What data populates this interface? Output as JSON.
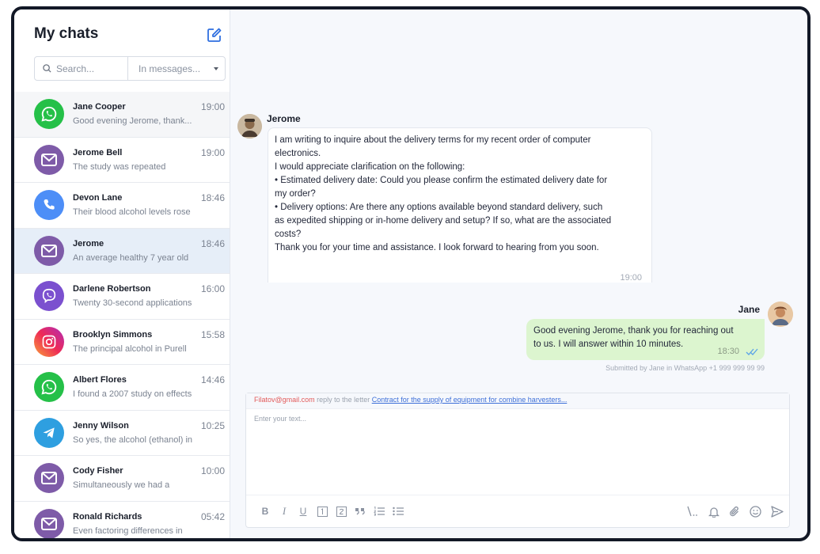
{
  "sidebar": {
    "title": "My chats",
    "search": {
      "placeholder": "Search...",
      "scope": "In messages..."
    },
    "chats": [
      {
        "name": "Jane Cooper",
        "time": "19:00",
        "preview": "Good evening Jerome, thank...",
        "channel": "whatsapp"
      },
      {
        "name": "Jerome Bell",
        "time": "19:00",
        "preview": "The study was repeated",
        "channel": "email"
      },
      {
        "name": "Devon Lane",
        "time": "18:46",
        "preview": "Their blood alcohol levels rose",
        "channel": "phone"
      },
      {
        "name": "Jerome",
        "time": "18:46",
        "preview": "An average healthy 7 year old",
        "channel": "email"
      },
      {
        "name": "Darlene Robertson",
        "time": "16:00",
        "preview": "Twenty 30-second applications",
        "channel": "viber"
      },
      {
        "name": "Brooklyn Simmons",
        "time": "15:58",
        "preview": "The principal alcohol in Purell",
        "channel": "instagram"
      },
      {
        "name": "Albert Flores",
        "time": "14:46",
        "preview": "I found a 2007 study on effects",
        "channel": "whatsapp"
      },
      {
        "name": "Jenny Wilson",
        "time": "10:25",
        "preview": "So yes, the alcohol (ethanol) in",
        "channel": "telegram"
      },
      {
        "name": "Cody Fisher",
        "time": "10:00",
        "preview": "Simultaneously we had a",
        "channel": "email"
      },
      {
        "name": "Ronald Richards",
        "time": "05:42",
        "preview": "Even factoring differences in",
        "channel": "email"
      }
    ]
  },
  "conversation": {
    "incoming": {
      "sender": "Jerome",
      "lines": [
        "I am writing to inquire about the delivery terms for my recent order of computer",
        "electronics.",
        "I would appreciate clarification on the following:",
        "• Estimated delivery date: Could you please confirm the estimated delivery date for",
        "my order?",
        "• Delivery options: Are there any options available beyond standard delivery, such",
        "as expedited shipping or in-home delivery and setup? If so, what are the associated",
        "costs?",
        "Thank you for your time and assistance. I look forward to hearing from you soon."
      ],
      "time": "19:00"
    },
    "outgoing": {
      "sender": "Jane",
      "lines": [
        "Good evening Jerome, thank you for reaching out",
        "to us. I will answer within 10 minutes."
      ],
      "time": "18:30",
      "meta": "Submitted by Jane in WhatsApp +1 999 999 99 99"
    }
  },
  "composer": {
    "reply_email": "Filatov@gmail.com",
    "reply_text": " reply to the letter ",
    "reply_subject": "Contract for the supply of equipment for combine harvesters...",
    "placeholder": "Enter your text...",
    "tools": {
      "bold": "B",
      "italic": "I",
      "underline": "U"
    }
  },
  "colors": {
    "whatsapp": "#25c048",
    "email": "#7e5ba8",
    "phone": "#4d8ef7",
    "viber": "#7b50cf",
    "telegram": "#2e9fe0",
    "accent": "#2f6fe0",
    "outgoing_bubble": "#dcf5cf",
    "active_row": "#e6eef8"
  }
}
